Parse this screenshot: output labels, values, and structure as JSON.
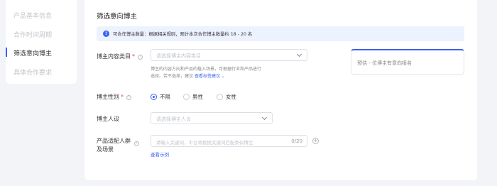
{
  "sidebar": {
    "items": [
      {
        "label": "产品基本信息"
      },
      {
        "label": "合作时间周期"
      },
      {
        "label": "筛选意向博主"
      },
      {
        "label": "具体合作要求"
      }
    ]
  },
  "section": {
    "title": "筛选意向博主"
  },
  "notice": {
    "text": "可合作博主数量：根据相关规则，预计本次合作博主数量约 18 - 20 名"
  },
  "category": {
    "label": "博主内容类目",
    "required_mark": "*",
    "placeholder": "请选择博主内容类目",
    "hint_line1": "博主的内容方向和产品的植入场景，可根据行业和产品进行",
    "hint_line2": "选择。若不选择，建议",
    "hint_link": "查看标签建议"
  },
  "preview": {
    "text": "预估 - 位博主有意向报名"
  },
  "gender": {
    "label": "博主性别",
    "required_mark": "*",
    "options": [
      {
        "label": "不限",
        "selected": true
      },
      {
        "label": "男性",
        "selected": false
      },
      {
        "label": "女性",
        "selected": false
      }
    ]
  },
  "persona": {
    "label": "博主人设",
    "placeholder": "请选择博主人设"
  },
  "audience": {
    "label_line1": "产品适配人群",
    "label_line2": "及场景",
    "placeholder": "请输入关键词，平台将根据关键词匹配类似博主",
    "count": "0/20",
    "example_link": "查看示例"
  },
  "icons": {
    "info": "info-icon",
    "help": "question-circle-icon",
    "dropdown": "chevron-down-icon",
    "add": "add-circle-icon"
  },
  "colors": {
    "accent": "#3a62f2",
    "required": "#f04848",
    "notice_bg": "#edf2ff"
  }
}
